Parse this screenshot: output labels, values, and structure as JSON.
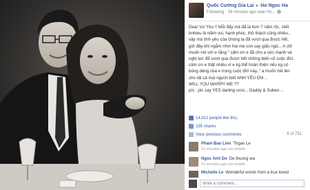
{
  "post": {
    "author": "Quốc Cường Gia Lai",
    "tagged": "Ho Ngoc Ha",
    "time": "Following · 39 minutes ago near Ho..."
  },
  "message": "Dear Vợ Yêu !! Mỗi đấy mà đã là hơn 7 năm rồi.. biết\nbnhieu là niềm vui, hạnh phúc, thử thách cũng nhiêu..\nvậy mà tình yêu của chúng ta đã vượt qua được hết..\ngiờ đây khi ngắm nhìn hai mẹ con say giấc ngủ... A chỉ\nmuốn nói với e rằng \" cảm ơn e đã cho a sức mạnh và\nnghị lực để vượt qua được hết những biến cố cuộc đời..\ncảm ơn e thật nhiều vì e kg thể hoàn thiện nếu kg có\nbóng dáng của e trong cuộc đời này..\" a muốn hét lên\ncho tất cả mọi người biết ANH YÊU EM ...\nWILL YOU MARRY ME ??\np/s : pls say YES darling xxxx... Daddy & Subeo ...",
  "likes_text": "14,812 people like this.",
  "shares_text": "195 shares",
  "view_previous": "View previous comments",
  "comment_count": "6 of 751",
  "comments": [
    {
      "name": "Pham Bao Lien",
      "text": "Thgan Le",
      "time": "10 minutes ago via mobile"
    },
    {
      "name": "Ngoc Anh Do",
      "text": "De thuong wa",
      "time": "10 minutes ago via mobile"
    },
    {
      "name": "Michelle Le",
      "text": "Wonderful words from a true loved",
      "time": ""
    }
  ],
  "write_placeholder": "Write a comment..."
}
